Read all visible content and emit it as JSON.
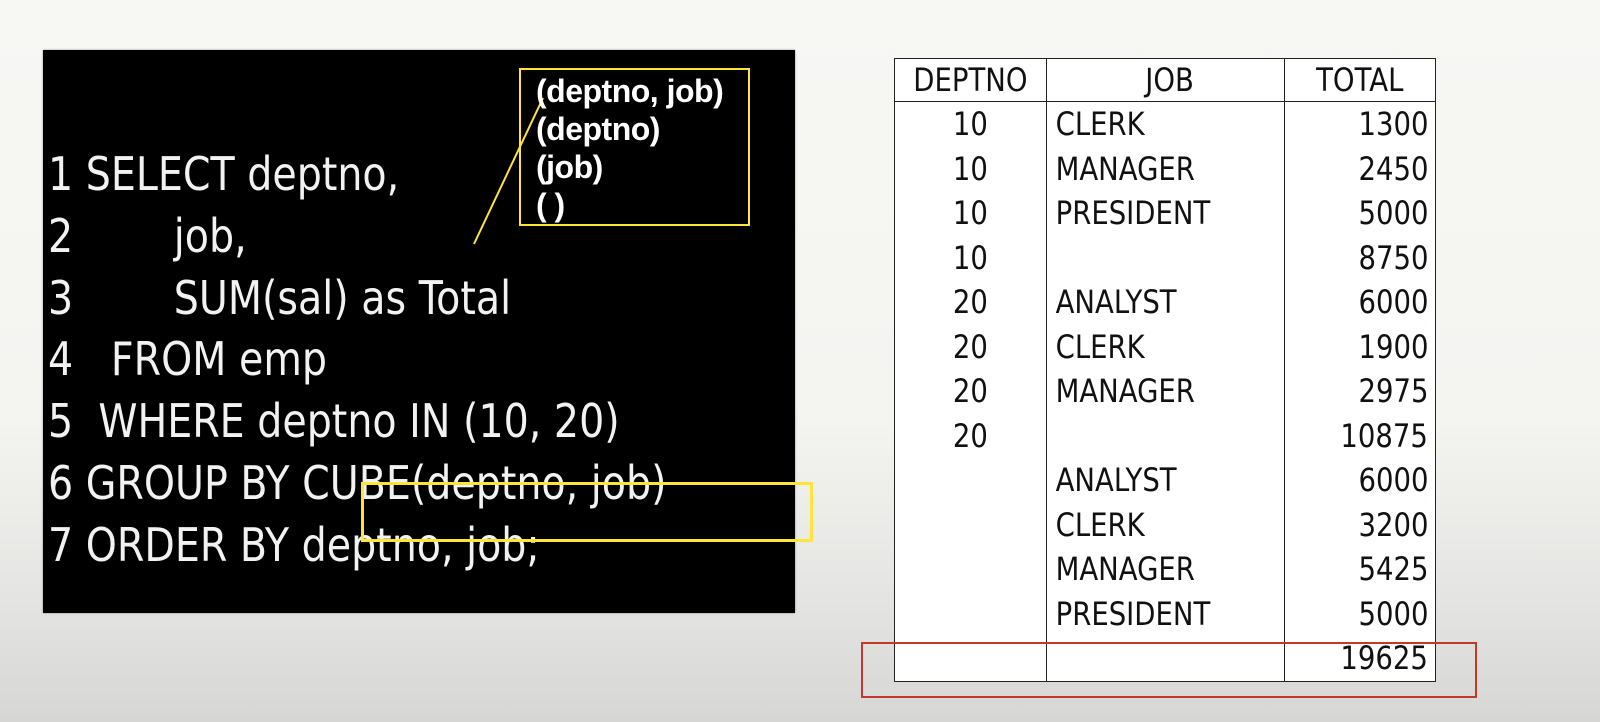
{
  "code": {
    "lines": [
      {
        "num": "1",
        "text": " SELECT deptno,"
      },
      {
        "num": "2",
        "text": "        job,"
      },
      {
        "num": "3",
        "text": "        SUM(sal) as Total"
      },
      {
        "num": "4",
        "text": "   FROM emp"
      },
      {
        "num": "5",
        "text": "  WHERE deptno IN (10, 20)"
      },
      {
        "num": "6",
        "text": " GROUP BY "
      },
      {
        "num": "7",
        "text": " ORDER BY deptno, job;"
      }
    ],
    "cube_expr": "CUBE(deptno, job)"
  },
  "grouping_sets": [
    "(deptno, job)",
    "(deptno)",
    "(job)",
    "( )"
  ],
  "table": {
    "headers": [
      "DEPTNO",
      "JOB",
      "TOTAL"
    ],
    "rows": [
      [
        "10",
        "CLERK",
        "1300"
      ],
      [
        "10",
        "MANAGER",
        "2450"
      ],
      [
        "10",
        "PRESIDENT",
        "5000"
      ],
      [
        "10",
        "",
        "8750"
      ],
      [
        "20",
        "ANALYST",
        "6000"
      ],
      [
        "20",
        "CLERK",
        "1900"
      ],
      [
        "20",
        "MANAGER",
        "2975"
      ],
      [
        "20",
        "",
        "10875"
      ],
      [
        "",
        "ANALYST",
        "6000"
      ],
      [
        "",
        "CLERK",
        "3200"
      ],
      [
        "",
        "MANAGER",
        "5425"
      ],
      [
        "",
        "PRESIDENT",
        "5000"
      ],
      [
        "",
        "",
        "19625"
      ]
    ]
  },
  "colors": {
    "highlight_yellow": "#ffe43a",
    "highlight_red": "#c0392b",
    "code_bg": "#000000"
  }
}
